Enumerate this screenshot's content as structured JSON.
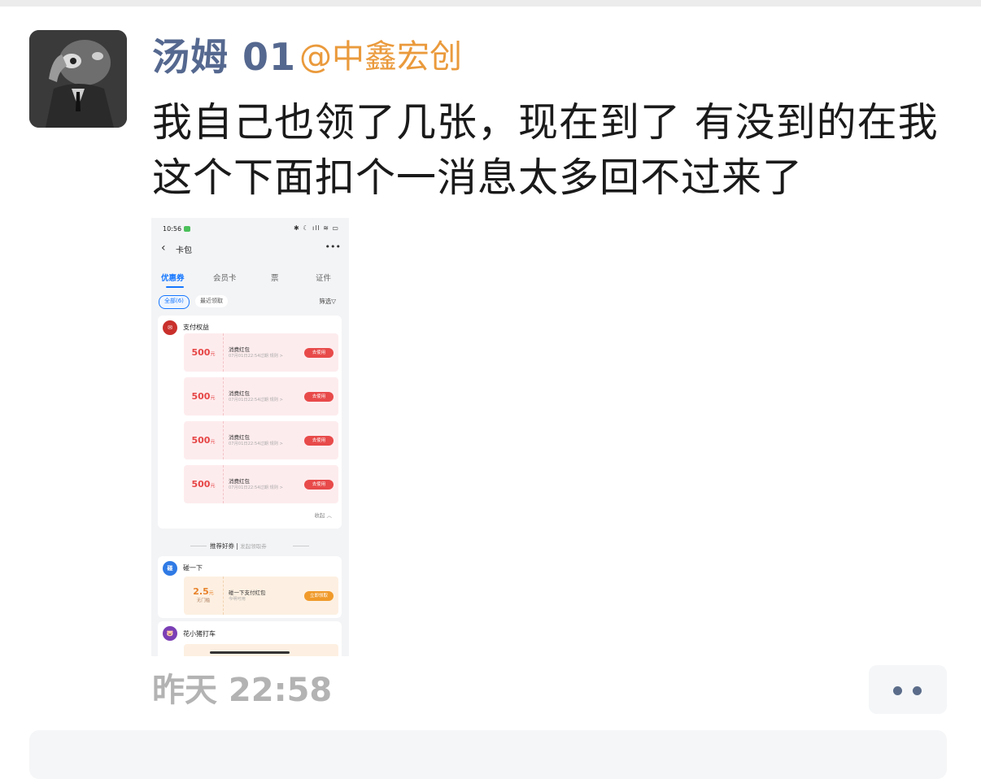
{
  "post": {
    "author": "汤姆 01",
    "mention": "@中鑫宏创",
    "message_lines": [
      "我自己也领了几张，现在到了 有没到的在我",
      "这个下面扣个一消息太多回不过来了"
    ],
    "time": "昨天 22:58"
  },
  "screenshot": {
    "status_time": "10:56",
    "status_icons": "✱ ☾ ıll ≋ ▭",
    "nav_title": "卡包",
    "tabs": [
      "优惠券",
      "会员卡",
      "票",
      "证件"
    ],
    "chips": [
      "全部(6)",
      "最近领取"
    ],
    "filter_label": "筛选▽",
    "group1": {
      "title": "支付权益",
      "coupons": [
        {
          "amount": "500",
          "unit": "元",
          "name": "消费红包",
          "sub": "07月01日22:54过期 规则 >",
          "button": "去使用"
        },
        {
          "amount": "500",
          "unit": "元",
          "name": "消费红包",
          "sub": "07月01日22:54过期 规则 >",
          "button": "去使用"
        },
        {
          "amount": "500",
          "unit": "元",
          "name": "消费红包",
          "sub": "07月01日22:54过期 规则 >",
          "button": "去使用"
        },
        {
          "amount": "500",
          "unit": "元",
          "name": "消费红包",
          "sub": "07月01日22:54过期 规则 >",
          "button": "去使用"
        }
      ],
      "collapse": "收起 ︿"
    },
    "recommend": {
      "label": "推荐好券",
      "sub": "发起领取券"
    },
    "group2": {
      "icon": "碰",
      "title": "碰一下",
      "coupon": {
        "amount": "2.5",
        "unit": "元",
        "threshold": "无门槛",
        "name": "碰一下支付红包",
        "sub": "今明可用",
        "button": "立即领取"
      }
    },
    "group3": {
      "title": "花小猪打车"
    }
  },
  "colors": {
    "author": "#55688f",
    "mention": "#ea9a3c",
    "time": "#b3b3b3",
    "accent_blue": "#1677ff",
    "coupon_red": "#e64545"
  }
}
